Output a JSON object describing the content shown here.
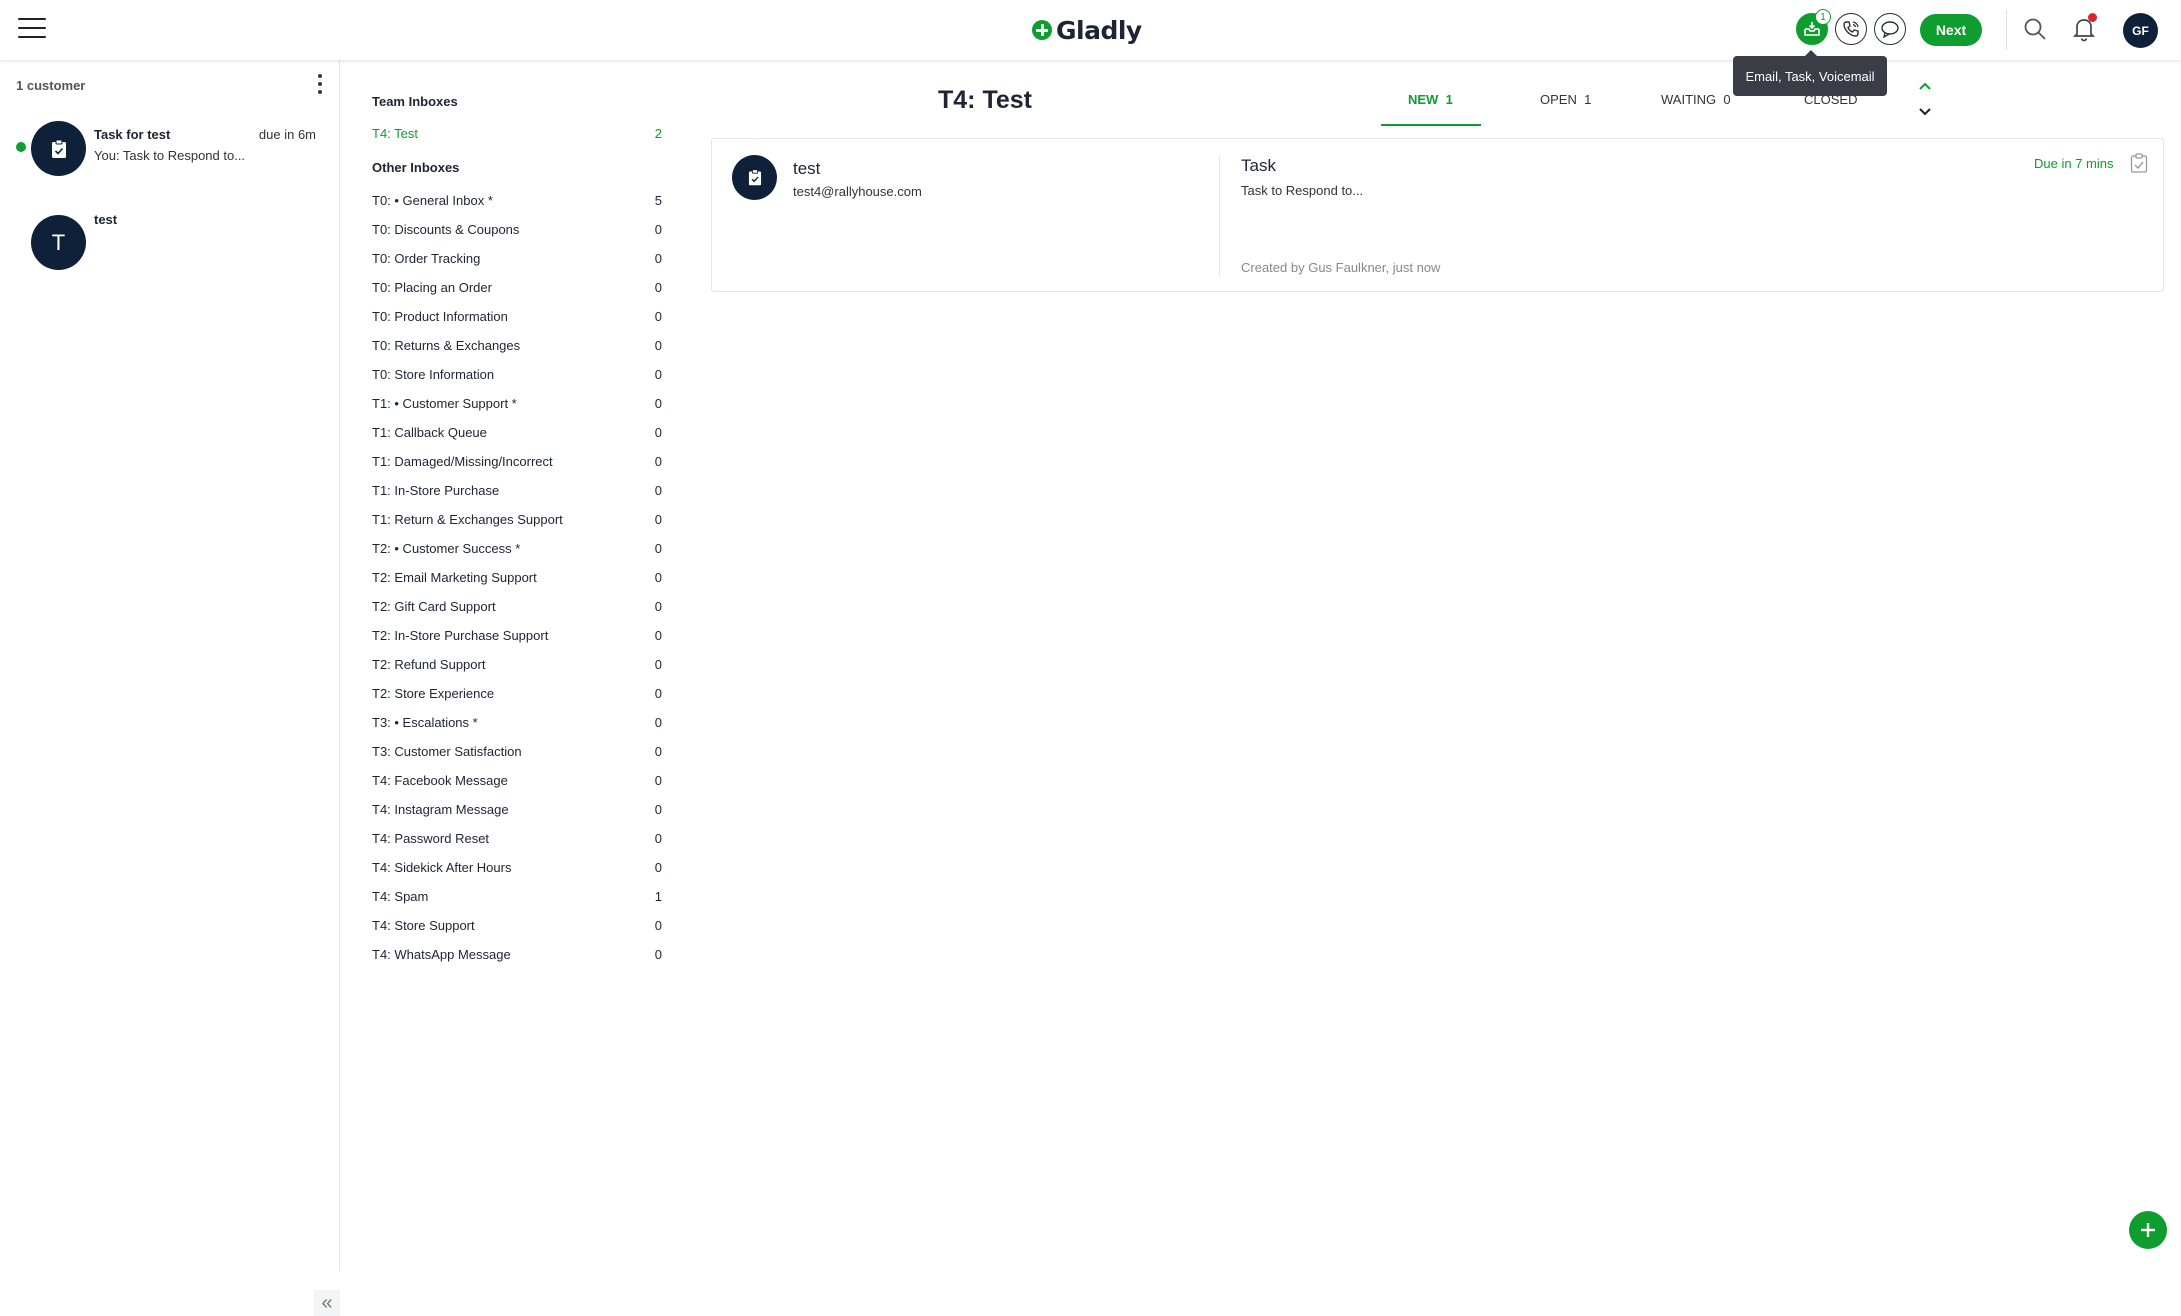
{
  "topbar": {
    "logo_text": "Gladly",
    "inbox_badge": "1",
    "next_label": "Next",
    "avatar_initials": "GF",
    "tooltip": "Email, Task, Voicemail",
    "icons": [
      "menu-icon",
      "inbox-icon",
      "phone-icon",
      "chat-icon",
      "search-icon",
      "bell-icon"
    ]
  },
  "customers": {
    "count_label": "1 customer",
    "items": [
      {
        "name": "Task for test",
        "due": "due in 6m",
        "preview": "You: Task to Respond to...",
        "avatar_icon": "clipboard-icon",
        "online": true
      },
      {
        "name": "test",
        "avatar_letter": "T"
      }
    ]
  },
  "inboxes": {
    "team_heading": "Team Inboxes",
    "team": [
      {
        "name": "T4: Test",
        "count": "2"
      }
    ],
    "other_heading": "Other Inboxes",
    "other": [
      {
        "name": "T0: • General Inbox *",
        "count": "5"
      },
      {
        "name": "T0: Discounts & Coupons",
        "count": "0"
      },
      {
        "name": "T0: Order Tracking",
        "count": "0"
      },
      {
        "name": "T0: Placing an Order",
        "count": "0"
      },
      {
        "name": "T0: Product Information",
        "count": "0"
      },
      {
        "name": "T0: Returns & Exchanges",
        "count": "0"
      },
      {
        "name": "T0: Store Information",
        "count": "0"
      },
      {
        "name": "T1: • Customer Support *",
        "count": "0"
      },
      {
        "name": "T1: Callback Queue",
        "count": "0"
      },
      {
        "name": "T1: Damaged/Missing/Incorrect",
        "count": "0"
      },
      {
        "name": "T1: In-Store Purchase",
        "count": "0"
      },
      {
        "name": "T1: Return & Exchanges Support",
        "count": "0"
      },
      {
        "name": "T2: • Customer Success *",
        "count": "0"
      },
      {
        "name": "T2: Email Marketing Support",
        "count": "0"
      },
      {
        "name": "T2: Gift Card Support",
        "count": "0"
      },
      {
        "name": "T2: In-Store Purchase Support",
        "count": "0"
      },
      {
        "name": "T2: Refund Support",
        "count": "0"
      },
      {
        "name": "T2: Store Experience",
        "count": "0"
      },
      {
        "name": "T3: • Escalations *",
        "count": "0"
      },
      {
        "name": "T3: Customer Satisfaction",
        "count": "0"
      },
      {
        "name": "T4: Facebook Message",
        "count": "0"
      },
      {
        "name": "T4: Instagram Message",
        "count": "0"
      },
      {
        "name": "T4: Password Reset",
        "count": "0"
      },
      {
        "name": "T4: Sidekick After Hours",
        "count": "0"
      },
      {
        "name": "T4: Spam",
        "count": "1"
      },
      {
        "name": "T4: Store Support",
        "count": "0"
      },
      {
        "name": "T4: WhatsApp Message",
        "count": "0"
      }
    ]
  },
  "main": {
    "title": "T4: Test",
    "tabs": [
      {
        "label": "NEW",
        "count": "1",
        "active": true
      },
      {
        "label": "OPEN",
        "count": "1"
      },
      {
        "label": "WAITING",
        "count": "0"
      },
      {
        "label": "CLOSED",
        "count": ""
      }
    ],
    "conversation": {
      "customer_name": "test",
      "customer_email": "test4@rallyhouse.com",
      "task_title": "Task",
      "task_text": "Task to Respond to...",
      "created": "Created by Gus Faulkner, just now",
      "due": "Due in 7 mins"
    }
  },
  "colors": {
    "accent": "#0f9d2f",
    "navy": "#0e2138",
    "alert": "#d9262c"
  }
}
